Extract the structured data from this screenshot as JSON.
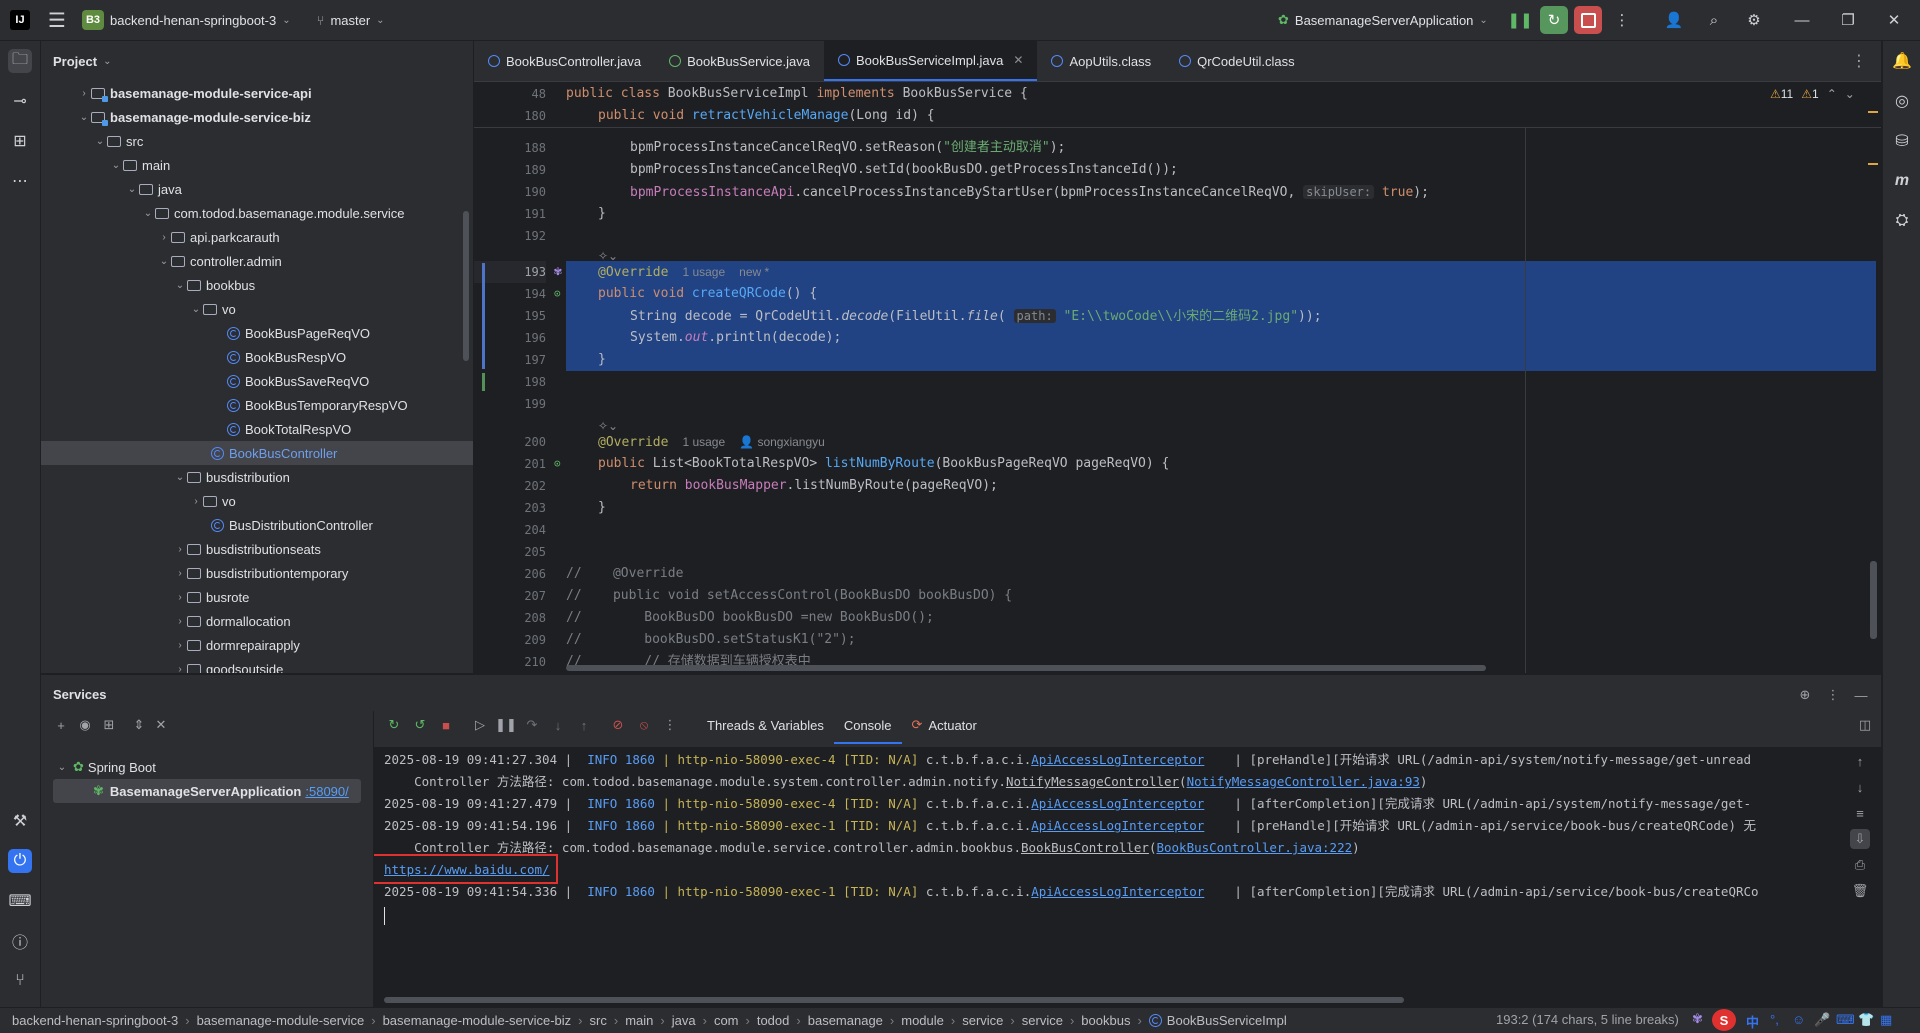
{
  "titlebar": {
    "project_badge": "B3",
    "project_name": "backend-henan-springboot-3",
    "branch": "master",
    "run_config": "BasemanageServerApplication"
  },
  "project_panel": {
    "title": "Project",
    "tree": [
      {
        "label": "basemanage-module-service-api",
        "bold": true
      },
      {
        "label": "basemanage-module-service-biz",
        "bold": true
      },
      {
        "label": "src"
      },
      {
        "label": "main"
      },
      {
        "label": "java"
      },
      {
        "label": "com.todod.basemanage.module.service"
      },
      {
        "label": "api.parkcarauth"
      },
      {
        "label": "controller.admin"
      },
      {
        "label": "bookbus"
      },
      {
        "label": "vo"
      },
      {
        "label": "BookBusPageReqVO"
      },
      {
        "label": "BookBusRespVO"
      },
      {
        "label": "BookBusSaveReqVO"
      },
      {
        "label": "BookBusTemporaryRespVO"
      },
      {
        "label": "BookTotalRespVO"
      },
      {
        "label": "BookBusController"
      },
      {
        "label": "busdistribution"
      },
      {
        "label": "vo"
      },
      {
        "label": "BusDistributionController"
      },
      {
        "label": "busdistributionseats"
      },
      {
        "label": "busdistributiontemporary"
      },
      {
        "label": "busrote"
      },
      {
        "label": "dormallocation"
      },
      {
        "label": "dormrepairapply"
      },
      {
        "label": "goodsoutside"
      }
    ]
  },
  "editor": {
    "tabs": [
      {
        "label": "BookBusController.java"
      },
      {
        "label": "BookBusService.java"
      },
      {
        "label": "BookBusServiceImpl.java"
      },
      {
        "label": "AopUtils.class"
      },
      {
        "label": "QrCodeUtil.class"
      }
    ],
    "inspections": {
      "warnings": "11",
      "weak": "1"
    },
    "line_numbers": [
      "48",
      "180",
      "188",
      "189",
      "190",
      "191",
      "192",
      "193",
      "194",
      "195",
      "196",
      "197",
      "198",
      "199",
      "200",
      "201",
      "202",
      "203",
      "204",
      "205",
      "206",
      "207",
      "208",
      "209",
      "210"
    ],
    "code": {
      "l48_a": "public class ",
      "l48_b": "BookBusServiceImpl ",
      "l48_c": "implements ",
      "l48_d": "BookBusService {",
      "l180_a": "public void ",
      "l180_b": "retractVehicleManage",
      "l180_c": "(Long id) {",
      "l188_a": "bpmProcessInstanceCancelReqVO.setReason(",
      "l188_b": "\"创建者主动取消\"",
      "l188_c": ");",
      "l189": "bpmProcessInstanceCancelReqVO.setId(bookBusDO.getProcessInstanceId());",
      "l190_a": "bpmProcessInstanceApi",
      "l190_b": ".cancelProcessInstanceByStartUser(bpmProcessInstanceCancelReqVO, ",
      "l190_hint": "skipUser:",
      "l190_c": " true",
      "l190_d": ");",
      "l191": "}",
      "l193_ann": "@Override",
      "l193_usage": "1 usage",
      "l193_new": "new *",
      "l194_a": "public void ",
      "l194_b": "createQRCode",
      "l194_c": "() {",
      "l195_a": "String decode = QrCodeUtil.",
      "l195_b": "decode",
      "l195_c": "(FileUtil.",
      "l195_d": "file",
      "l195_e": "( ",
      "l195_hint": "path:",
      "l195_f": " \"E:\\\\twoCode\\\\小宋的二维码2.jpg\"",
      "l195_g": "));",
      "l196_a": "System.",
      "l196_b": "out",
      "l196_c": ".println(decode);",
      "l197": "}",
      "l200_ann": "@Override",
      "l200_usage": "1 usage",
      "l200_author": "songxiangyu",
      "l201_a": "public ",
      "l201_b": "List<BookTotalRespVO> ",
      "l201_c": "listNumByRoute",
      "l201_d": "(BookBusPageReqVO pageReqVO) {",
      "l202_a": "return ",
      "l202_b": "bookBusMapper",
      "l202_c": ".listNumByRoute(pageReqVO);",
      "l203": "}",
      "l206": "//    @Override",
      "l207": "//    public void setAccessControl(BookBusDO bookBusDO) {",
      "l208": "//        BookBusDO bookBusDO =new BookBusDO();",
      "l209": "//        bookBusDO.setStatusK1(\"2\");",
      "l210": "//        // 存储数据到车辆授权表中"
    }
  },
  "services": {
    "title": "Services",
    "tree": {
      "group": "Spring Boot",
      "app": "BasemanageServerApplication",
      "port": ":58090/"
    },
    "tabs": [
      {
        "label": "Threads & Variables"
      },
      {
        "label": "Console"
      },
      {
        "label": "Actuator"
      }
    ],
    "console": {
      "l1_time": "2025-08-19 09:41:27.304 | ",
      "l1_info": " INFO 1860 ",
      "l1_thread": "| http-nio-58090-exec-4 [TID: N/A] ",
      "l1_cls": "c.t.b.f.a.c.i.",
      "l1_cls2": "ApiAccessLogInterceptor",
      "l1_msg": "    | [preHandle][开始请求 URL(/admin-api/system/notify-message/get-unread",
      "l2_a": "    Controller 方法路径: com.todod.basemanage.module.system.controller.admin.notify.",
      "l2_b": "NotifyMessageController",
      "l2_c": "(",
      "l2_link": "NotifyMessageController.java:93",
      "l2_d": ")",
      "l3_time": "2025-08-19 09:41:27.479 | ",
      "l3_info": " INFO 1860 ",
      "l3_thread": "| http-nio-58090-exec-4 [TID: N/A] ",
      "l3_cls": "c.t.b.f.a.c.i.",
      "l3_cls2": "ApiAccessLogInterceptor",
      "l3_msg": "    | [afterCompletion][完成请求 URL(/admin-api/system/notify-message/get-",
      "l4_time": "2025-08-19 09:41:54.196 | ",
      "l4_info": " INFO 1860 ",
      "l4_thread": "| http-nio-58090-exec-1 [TID: N/A] ",
      "l4_cls": "c.t.b.f.a.c.i.",
      "l4_cls2": "ApiAccessLogInterceptor",
      "l4_msg": "    | [preHandle][开始请求 URL(/admin-api/service/book-bus/createQRCode) 无",
      "l5_a": "    Controller 方法路径: com.todod.basemanage.module.service.controller.admin.bookbus.",
      "l5_b": "BookBusController",
      "l5_c": "(",
      "l5_link": "BookBusController.java:222",
      "l5_d": ")",
      "l6_url": "https://www.baidu.com/",
      "l7_time": "2025-08-19 09:41:54.336 | ",
      "l7_info": " INFO 1860 ",
      "l7_thread": "| http-nio-58090-exec-1 [TID: N/A] ",
      "l7_cls": "c.t.b.f.a.c.i.",
      "l7_cls2": "ApiAccessLogInterceptor",
      "l7_msg": "    | [afterCompletion][完成请求 URL(/admin-api/service/book-bus/createQRCo"
    }
  },
  "statusbar": {
    "breadcrumbs": [
      "backend-henan-springboot-3",
      "basemanage-module-service",
      "basemanage-module-service-biz",
      "src",
      "main",
      "java",
      "com",
      "todod",
      "basemanage",
      "module",
      "service",
      "service",
      "bookbus",
      "BookBusServiceImpl"
    ],
    "position": "193:2 (174 chars, 5 line breaks)",
    "ime": "中"
  },
  "colors": {
    "accent": "#3574f0",
    "selection": "#214283",
    "highlight_box": "#e03131"
  }
}
